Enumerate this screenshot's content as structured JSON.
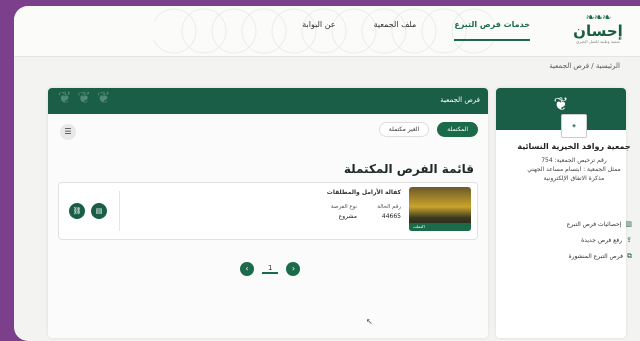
{
  "logo": {
    "mark": "❧❧❧",
    "name": "إحسان",
    "tagline": "منصة وطنية للعمل الخيري"
  },
  "nav": [
    {
      "label": "خدمات فرص التبرع",
      "active": true
    },
    {
      "label": "ملف الجمعية",
      "active": false
    },
    {
      "label": "عن البوابة",
      "active": false
    }
  ],
  "breadcrumb": "الرئيسية / فرص الجمعية",
  "sidebar": {
    "org_name": "جمعية روافد الخيرية النسائية",
    "license": "رقم ترخيص الجمعية: 754",
    "rep": "ممثل الجمعية : ابتسام مساعد الجهني",
    "memo": "مذكرة الاتفاق الإلكترونية",
    "menu": [
      {
        "label": "إحصائيات فرص التبرع",
        "icon": "chart-icon"
      },
      {
        "label": "رفع فرص جديدة",
        "icon": "upload-icon"
      },
      {
        "label": "فرص التبرع المنشورة",
        "icon": "published-icon"
      }
    ]
  },
  "main": {
    "header_title": "فرص الجمعية",
    "tabs": [
      {
        "label": "المكتملة",
        "active": true
      },
      {
        "label": "الغير مكتملة",
        "active": false
      }
    ],
    "list_title": "قائمة الفرص المكتملة",
    "card": {
      "title": "كفالة الأرامل والمطلقات",
      "case_no_label": "رقم الحالة",
      "case_no": "44665",
      "type_label": "نوع الفرصة",
      "type": "مشروع",
      "status": "اكتملت"
    },
    "pager": {
      "page": "1"
    }
  }
}
